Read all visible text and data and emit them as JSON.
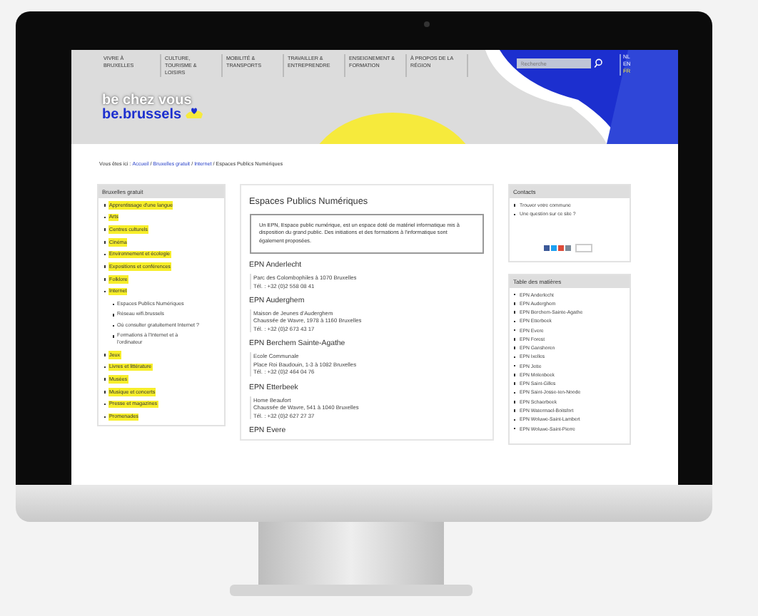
{
  "header": {
    "nav": [
      "VIVRE À BRUXELLES",
      "CULTURE, TOURISME & LOISIRS",
      "MOBILITÉ & TRANSPORTS",
      "TRAVAILLER & ENTREPRENDRE",
      "ENSEIGNEMENT & FORMATION",
      "À PROPOS DE LA RÉGION"
    ],
    "search": {
      "placeholder": "Recherche"
    },
    "languages": [
      {
        "label": "NL",
        "selected": false
      },
      {
        "label": "EN",
        "selected": false
      },
      {
        "label": "FR",
        "selected": true
      }
    ],
    "logo": {
      "line_1": "be chez vous",
      "line_2": "be.brussels"
    }
  },
  "breadcrumb": {
    "prefix": "Vous êtes ici :",
    "links": [
      "Accueil",
      "Bruxelles gratuit",
      "Internet"
    ],
    "separator": "/",
    "current": "Espaces Publics Numériques"
  },
  "sidebar": {
    "title": "Bruxelles gratuit",
    "items": [
      {
        "label": "Apprentissage d'une langue"
      },
      {
        "label": "Arts"
      },
      {
        "label": "Centres culturels"
      },
      {
        "label": "Cinéma"
      },
      {
        "label": "Environnement et écologie"
      },
      {
        "label": "Expositions et conférences"
      },
      {
        "label": "Folklore"
      },
      {
        "label": "Internet",
        "children": [
          {
            "label": "Espaces Publics Numériques"
          },
          {
            "label": "Réseau wifi.brussels"
          },
          {
            "label": "Où consulter gratuitement Internet ?"
          },
          {
            "label": "Formations à l'Internet et à l'ordinateur"
          }
        ]
      },
      {
        "label": "Jeux"
      },
      {
        "label": "Livres et littérature"
      },
      {
        "label": "Musées"
      },
      {
        "label": "Musique et concerts"
      },
      {
        "label": "Presse et magazines"
      },
      {
        "label": "Promenades"
      }
    ]
  },
  "main": {
    "title": "Espaces Publics Numériques",
    "intro": "Un EPN, Espace public numérique, est un espace doté de matériel informatique mis à disposition du grand public. Des initiations et des formations à l'informatique sont également proposées.",
    "entries": [
      {
        "title": "EPN Anderlecht",
        "lines": [
          "Parc des Colombophiles à 1070 Bruxelles",
          "Tél. : +32 (0)2 558 08 41"
        ]
      },
      {
        "title": "EPN Auderghem",
        "lines": [
          "Maison de Jeunes d'Auderghem",
          "Chaussée de Wavre, 1978 à 1160 Bruxelles",
          "Tél. : +32 (0)2 673 43 17"
        ]
      },
      {
        "title": "EPN Berchem Sainte-Agathe",
        "lines": [
          "Ecole Communale",
          "Place Roi Baudouin, 1-3 à 1082 Bruxelles",
          "Tél. : +32 (0)2 464 04 76"
        ]
      },
      {
        "title": "EPN Etterbeek",
        "lines": [
          "Home Beaufort",
          "Chaussée de Wavre, 541 à 1040 Bruxelles",
          "Tél. : +32 (0)2 627 27 37"
        ]
      },
      {
        "title": "EPN Evere"
      }
    ]
  },
  "contacts": {
    "title": "Contacts",
    "links": [
      "Trouver votre commune",
      "Une question sur ce site ?"
    ]
  },
  "toc": {
    "title": "Table des matières",
    "items": [
      "EPN Anderlecht",
      "EPN Auderghem",
      "EPN Berchem-Sainte-Agathe",
      "EPN Etterbeek",
      "EPN Evere",
      "EPN Forest",
      "EPN Ganshoren",
      "EPN Ixelles",
      "EPN Jette",
      "EPN Molenbeek",
      "EPN Saint-Gilles",
      "EPN Saint-Josse-ten-Noode",
      "EPN Schaerbeek",
      "EPN Watermael-Boitsfort",
      "EPN Woluwe-Saint-Lambert",
      "EPN Woluwe-Saint-Pierre"
    ]
  }
}
